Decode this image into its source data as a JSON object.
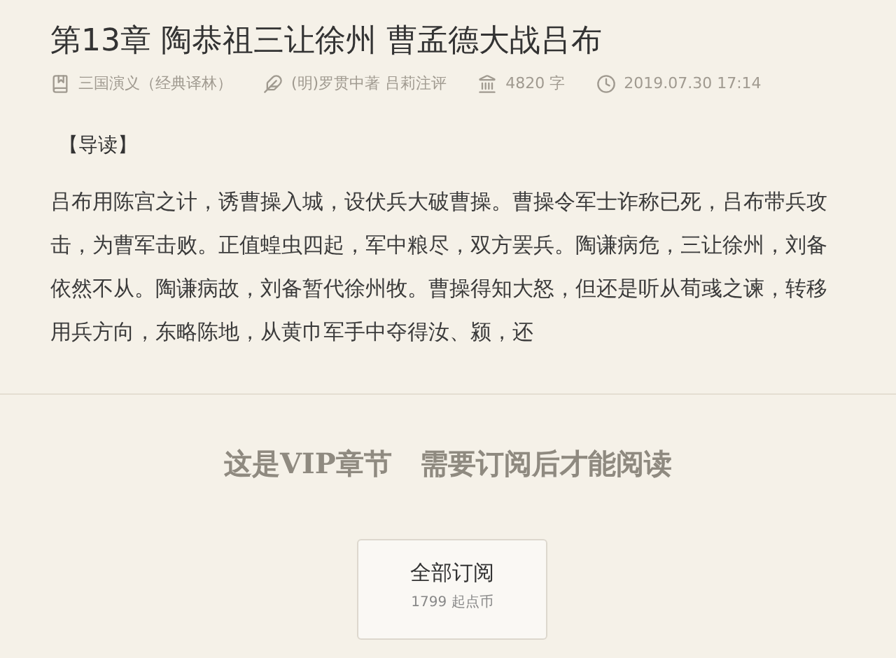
{
  "chapter_title": "第13章 陶恭祖三让徐州 曹孟德大战吕布",
  "meta": [
    {
      "kind": "book",
      "text": "三国演义（经典译林）"
    },
    {
      "kind": "author",
      "text": "(明)罗贯中著 吕莉注评"
    },
    {
      "kind": "words",
      "text": "4820 字"
    },
    {
      "kind": "time",
      "text": "2019.07.30 17:14"
    }
  ],
  "intro_heading": "【导读】",
  "intro_text": "吕布用陈宫之计，诱曹操入城，设伏兵大破曹操。曹操令军士诈称已死，吕布带兵攻击，为曹军击败。正值蝗虫四起，军中粮尽，双方罢兵。陶谦病危，三让徐州，刘备依然不从。陶谦病故，刘备暂代徐州牧。曹操得知大怒，但还是听从荀彧之谏，转移用兵方向，东略陈地，从黄巾军手中夺得汝、颍，还",
  "vip_notice": "这是VIP章节　需要订阅后才能阅读",
  "subscribe_button": {
    "label": "全部订阅",
    "price": "1799 起点币"
  }
}
